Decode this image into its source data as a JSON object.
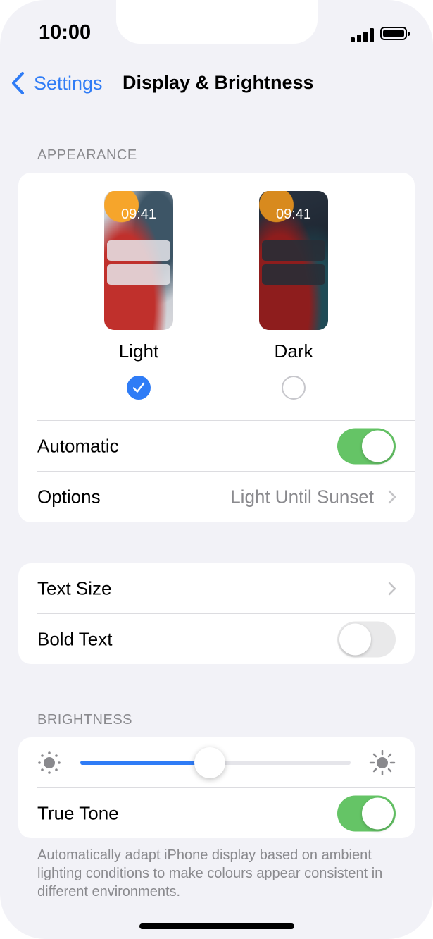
{
  "status_bar": {
    "time": "10:00"
  },
  "nav": {
    "back_label": "Settings",
    "title": "Display & Brightness"
  },
  "appearance": {
    "header": "APPEARANCE",
    "light": {
      "clock": "09:41",
      "label": "Light",
      "selected": true
    },
    "dark": {
      "clock": "09:41",
      "label": "Dark",
      "selected": false
    },
    "automatic": {
      "label": "Automatic",
      "on": true
    },
    "options": {
      "label": "Options",
      "value": "Light Until Sunset"
    }
  },
  "text": {
    "text_size": {
      "label": "Text Size"
    },
    "bold_text": {
      "label": "Bold Text",
      "on": false
    }
  },
  "brightness": {
    "header": "BRIGHTNESS",
    "level": 0.48,
    "true_tone": {
      "label": "True Tone",
      "on": true
    },
    "footer": "Automatically adapt iPhone display based on ambient lighting conditions to make colours appear consistent in different environments."
  },
  "colors": {
    "accent": "#2f7cf6",
    "toggle_on": "#65c466",
    "secondary_text": "#8a8a8e"
  }
}
